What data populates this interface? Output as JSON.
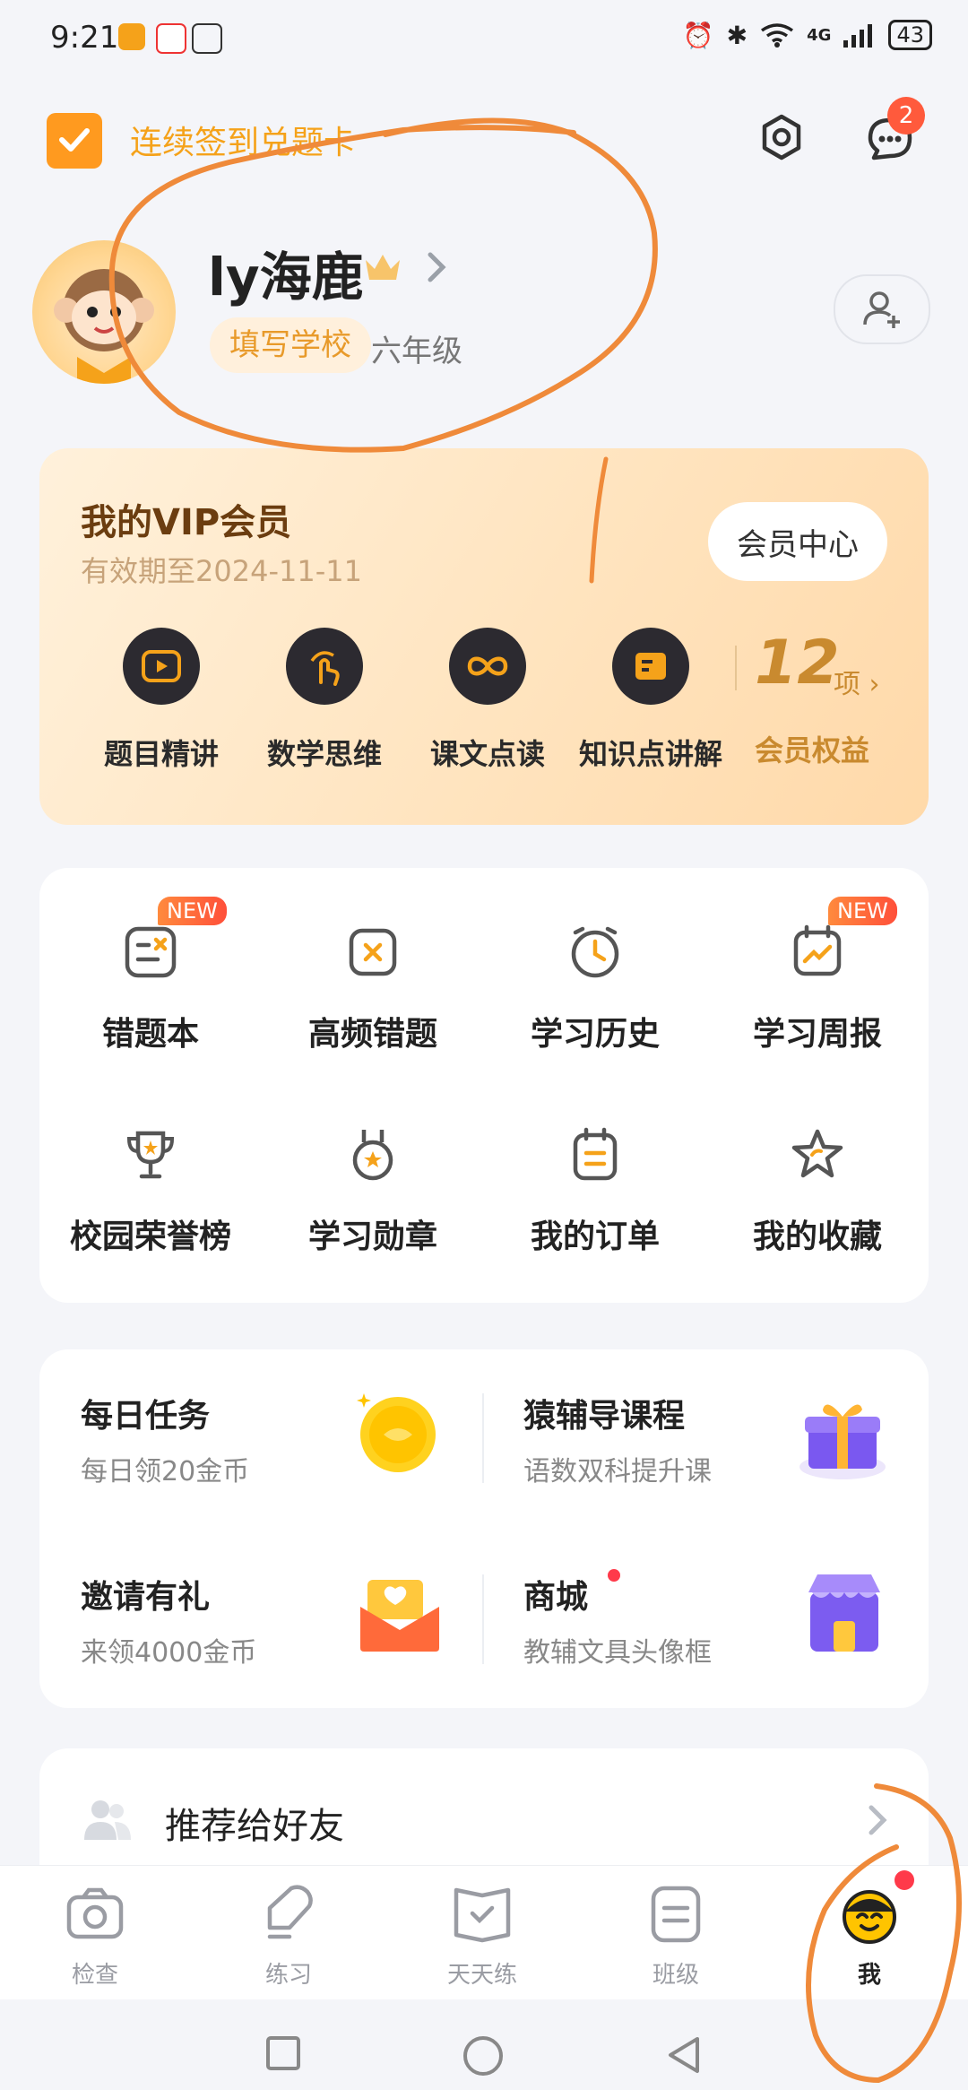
{
  "status_bar": {
    "time": "9:21",
    "network": "4G",
    "battery": "43"
  },
  "header": {
    "signin_text": "连续签到兑题卡",
    "message_badge": "2"
  },
  "profile": {
    "username": "ly海鹿",
    "school_button": "填写学校",
    "grade": "六年级"
  },
  "vip": {
    "title": "我的VIP会员",
    "expiry": "有效期至2024-11-11",
    "center_button": "会员中心",
    "items": [
      {
        "label": "题目精讲",
        "icon": "play-icon"
      },
      {
        "label": "数学思维",
        "icon": "finger-tap-icon"
      },
      {
        "label": "课文点读",
        "icon": "infinity-icon"
      },
      {
        "label": "知识点讲解",
        "icon": "card-icon"
      }
    ],
    "benefit_count": "12",
    "benefit_unit": "项",
    "benefit_label": "会员权益"
  },
  "grid": {
    "new_badge": "NEW",
    "items": [
      {
        "label": "错题本",
        "icon": "mistake-book-icon",
        "is_new": true
      },
      {
        "label": "高频错题",
        "icon": "frequent-mistake-icon",
        "is_new": false
      },
      {
        "label": "学习历史",
        "icon": "clock-icon",
        "is_new": false
      },
      {
        "label": "学习周报",
        "icon": "weekly-report-icon",
        "is_new": true
      },
      {
        "label": "校园荣誉榜",
        "icon": "trophy-icon",
        "is_new": false
      },
      {
        "label": "学习勋章",
        "icon": "medal-icon",
        "is_new": false
      },
      {
        "label": "我的订单",
        "icon": "order-icon",
        "is_new": false
      },
      {
        "label": "我的收藏",
        "icon": "star-icon",
        "is_new": false
      }
    ]
  },
  "tasks": [
    {
      "title": "每日任务",
      "subtitle": "每日领20金币",
      "icon": "gold-coin-icon"
    },
    {
      "title": "猿辅导课程",
      "subtitle": "语数双科提升课",
      "icon": "gift-box-icon"
    },
    {
      "title": "邀请有礼",
      "subtitle": "来领4000金币",
      "icon": "envelope-icon"
    },
    {
      "title": "商城",
      "subtitle": "教辅文具头像框",
      "icon": "shop-icon"
    }
  ],
  "recommend": {
    "label": "推荐给好友"
  },
  "bottom_nav": {
    "items": [
      {
        "label": "检查",
        "icon": "camera-icon"
      },
      {
        "label": "练习",
        "icon": "pencil-icon"
      },
      {
        "label": "天天练",
        "icon": "daily-practice-icon"
      },
      {
        "label": "班级",
        "icon": "class-icon"
      },
      {
        "label": "我",
        "icon": "me-face-icon"
      }
    ],
    "active": "我"
  },
  "colors": {
    "accent": "#f5a21a",
    "vip_text": "#6b3d10",
    "badge": "#ff5a3c",
    "annotation": "#ef8a3a"
  }
}
